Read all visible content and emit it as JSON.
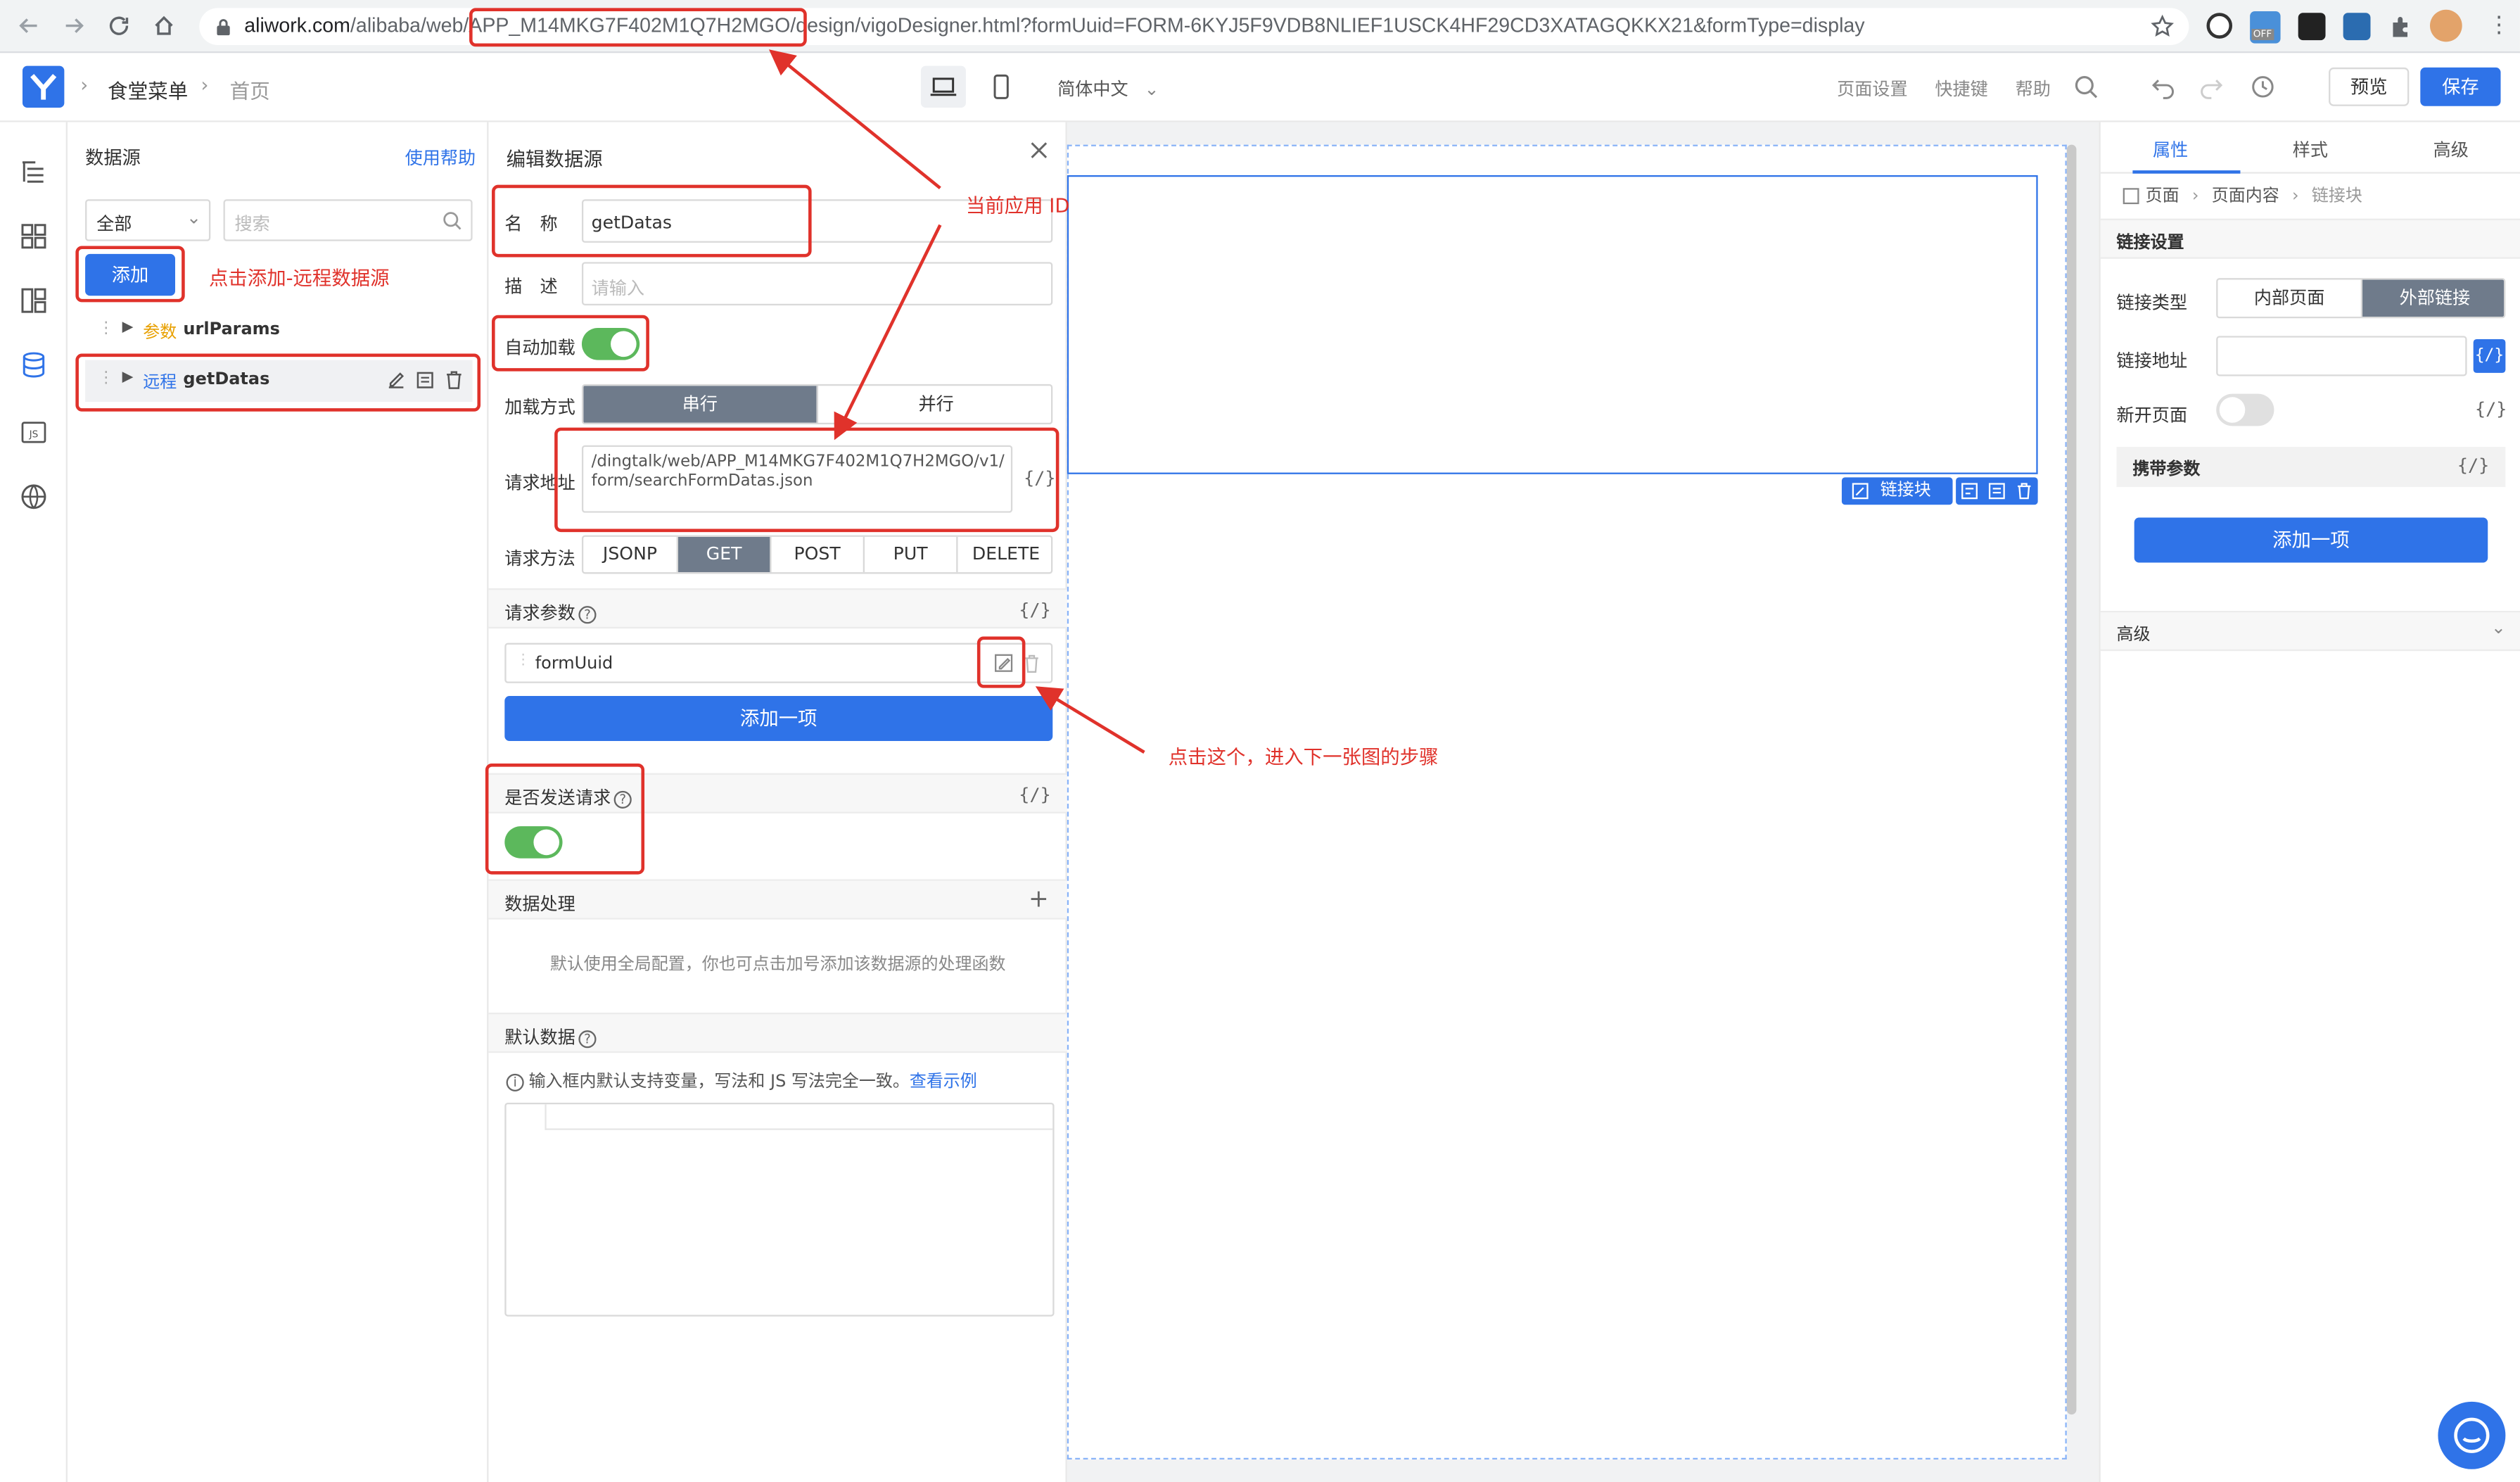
{
  "browser": {
    "url_host": "aliwork.com",
    "url_path": "/alibaba/web/APP_M14MKG7F402M1Q7H2MGO/design/vigoDesigner.html?formUuid=FORM-6KYJ5F9VDB8NLIEF1USCK4HF29CD3XATAGQKKX21&formType=display",
    "ext_badge": "OFF"
  },
  "header": {
    "app_name": "食堂菜单",
    "page_name": "首页",
    "language": "简体中文",
    "page_settings": "页面设置",
    "shortcuts": "快捷键",
    "help": "帮助",
    "preview": "预览",
    "save": "保存"
  },
  "datasource_panel": {
    "title": "数据源",
    "help_link": "使用帮助",
    "filter_value": "全部",
    "search_placeholder": "搜索",
    "add_button": "添加",
    "items": [
      {
        "tag": "参数",
        "name": "urlParams"
      },
      {
        "tag": "远程",
        "name": "getDatas"
      }
    ]
  },
  "edit_panel": {
    "title": "编辑数据源",
    "name_label": "名　称",
    "name_value": "getDatas",
    "desc_label": "描　述",
    "desc_placeholder": "请输入",
    "autoload_label": "自动加载",
    "load_mode_label": "加载方式",
    "load_modes": [
      "串行",
      "并行"
    ],
    "url_label": "请求地址",
    "url_value": "/dingtalk/web/APP_M14MKG7F402M1Q7H2MGO/v1/form/searchFormDatas.json",
    "method_label": "请求方法",
    "methods": [
      "JSONP",
      "GET",
      "POST",
      "PUT",
      "DELETE"
    ],
    "params_label": "请求参数",
    "param_key": "formUuid",
    "add_item": "添加一项",
    "send_label": "是否发送请求",
    "data_process_label": "数据处理",
    "data_process_hint": "默认使用全局配置，你也可点击加号添加该数据源的处理函数",
    "default_data_label": "默认数据",
    "default_data_hint": "输入框内默认支持变量，写法和 JS 写法完全一致。",
    "example_link": "查看示例",
    "code_icon": "{/}"
  },
  "canvas": {
    "link_block_label": "链接块"
  },
  "props_panel": {
    "tabs": [
      "属性",
      "样式",
      "高级"
    ],
    "breadcrumb": [
      "页面",
      "页面内容",
      "链接块"
    ],
    "link_settings": "链接设置",
    "link_type_label": "链接类型",
    "link_types": [
      "内部页面",
      "外部链接"
    ],
    "link_url_label": "链接地址",
    "new_page_label": "新开页面",
    "carry_params_label": "携带参数",
    "add_item": "添加一项",
    "advanced": "高级"
  },
  "annotations": {
    "add_remote": "点击添加-远程数据源",
    "current_app_id": "当前应用  ID",
    "click_next": "点击这个，进入下一张图的步骤"
  },
  "colors": {
    "primary": "#2f73e8",
    "toggle_on": "#5cb85c",
    "annotation": "#e0322b",
    "selected_segment": "#6f7b8b"
  }
}
